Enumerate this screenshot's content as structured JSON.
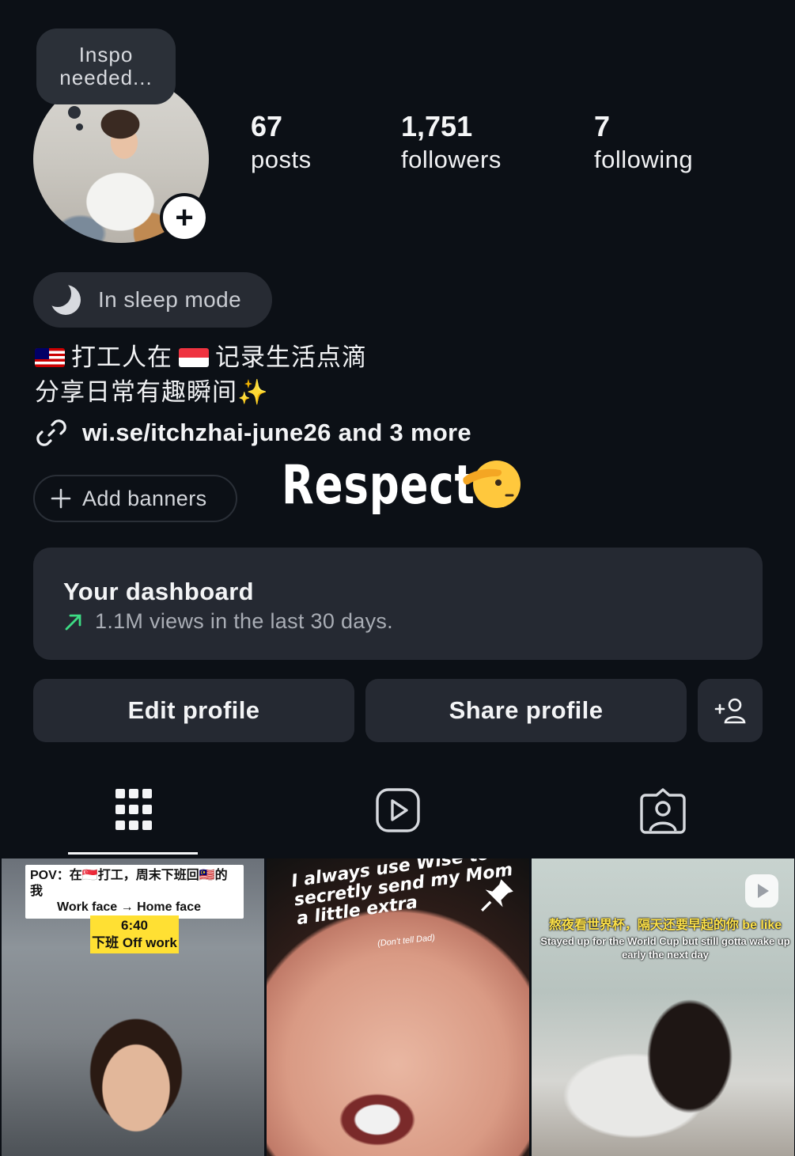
{
  "profile": {
    "note": [
      "Inspo",
      "needed..."
    ],
    "stats": [
      {
        "value": "67",
        "label": "posts"
      },
      {
        "value": "1,751",
        "label": "followers"
      },
      {
        "value": "7",
        "label": "following"
      }
    ],
    "status": "In sleep mode",
    "bio_line1_a": "打工人在",
    "bio_line1_b": "记录生活点滴",
    "bio_line2": "分享日常有趣瞬间",
    "link": "wi.se/itchzhai-june26 and 3 more",
    "add_banners": "Add banners",
    "overlay_text": "Respect"
  },
  "dashboard": {
    "title": "Your dashboard",
    "subtitle": "1.1M views in the last 30 days."
  },
  "buttons": {
    "edit": "Edit profile",
    "share": "Share profile"
  },
  "tabs": [
    "grid-icon",
    "reels-icon",
    "tagged-icon"
  ],
  "posts": [
    {
      "pov": "POV：在🇸🇬打工，周末下班回🇲🇾的我",
      "pov2": "Work face → Home face",
      "time": "6:40",
      "off": "下班 Off work"
    },
    {
      "caption": "I always use Wise to secretly send my Mom a little extra",
      "small": "(Don't tell Dad)"
    },
    {
      "headline": "熬夜看世界杯，隔天还要早起的你 be like",
      "sub": "Stayed up for the World Cup but still gotta wake up early the next day"
    }
  ],
  "colors": {
    "background": "#0c1016",
    "card": "#252932",
    "accent_green": "#3ddc84"
  }
}
